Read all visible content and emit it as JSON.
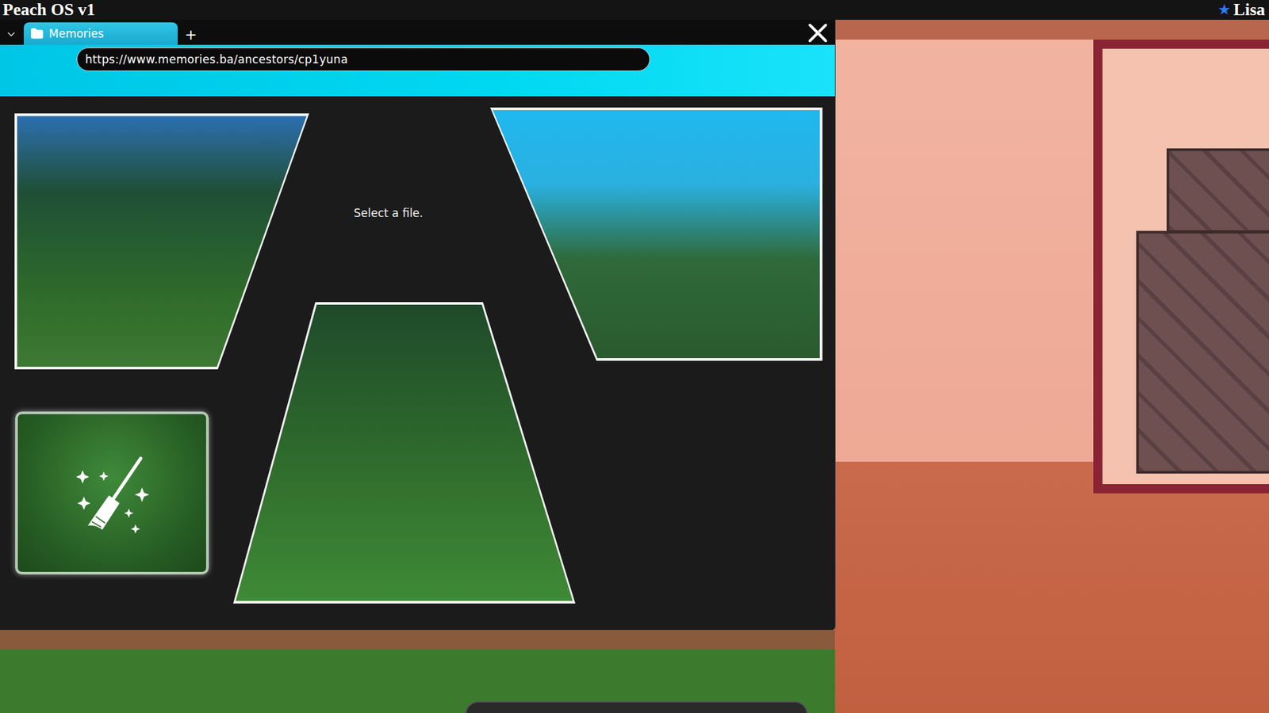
{
  "top_bar": {
    "title": "Peach OS v1",
    "user": {
      "icon": "★",
      "name": "Lisa"
    }
  },
  "browser": {
    "tabs": [
      {
        "label": "Memories",
        "selected": true
      }
    ],
    "new_tab": "+",
    "address": "https://www.memories.ba/ancestors/cp1yuna"
  },
  "gallery": {
    "prompt": "Select a file."
  }
}
